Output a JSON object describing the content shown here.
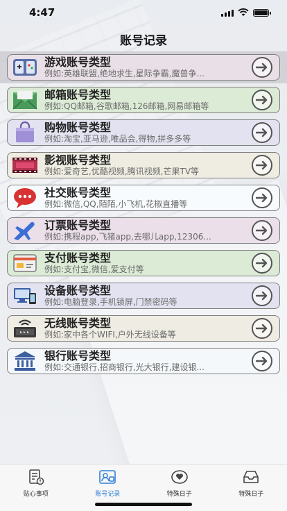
{
  "status": {
    "time": "4:47"
  },
  "nav": {
    "title": "账号记录"
  },
  "items": [
    {
      "title": "游戏账号类型",
      "subtitle": "例如:英雄联盟,绝地求生,星际争霸,魔兽争...",
      "bg": "#e9dfe6",
      "icon": "gamepad-icon"
    },
    {
      "title": "邮箱账号类型",
      "subtitle": "例如:QQ邮箱,谷歌邮箱,126邮箱,网易邮箱等",
      "bg": "#dcebd6",
      "icon": "envelope-icon"
    },
    {
      "title": "购物账号类型",
      "subtitle": "例如:淘宝,亚马逊,唯品会,得物,拼多多等",
      "bg": "#e2e2f0",
      "icon": "shopping-bag-icon"
    },
    {
      "title": "影视账号类型",
      "subtitle": "例如:爱奇艺,优酷视频,腾讯视频,芒果TV等",
      "bg": "#efece1",
      "icon": "film-icon"
    },
    {
      "title": "社交账号类型",
      "subtitle": "例如:微信,QQ,陌陌,小飞机,花椒直播等",
      "bg": "#f7fbfd",
      "icon": "chat-bubble-icon"
    },
    {
      "title": "订票账号类型",
      "subtitle": "例如:携程app,飞猪app,去哪儿app,12306...",
      "bg": "#ebdfe9",
      "icon": "airplane-icon"
    },
    {
      "title": "支付账号类型",
      "subtitle": "例如:支付宝,微信,爱支付等",
      "bg": "#dcebd6",
      "icon": "payment-card-icon"
    },
    {
      "title": "设备账号类型",
      "subtitle": "例如:电脑登录,手机锁屏,门禁密码等",
      "bg": "#e2e2f0",
      "icon": "devices-icon"
    },
    {
      "title": "无线账号类型",
      "subtitle": "例如:家中各个WIFI,户外无线设备等",
      "bg": "#eeece3",
      "icon": "wifi-router-icon"
    },
    {
      "title": "银行账号类型",
      "subtitle": "例如:交通银行,招商银行,光大银行,建设银...",
      "bg": "#f4f8fa",
      "icon": "bank-icon"
    }
  ],
  "tabs": [
    {
      "label": "贴心事项",
      "icon": "notes-icon",
      "active": false
    },
    {
      "label": "账号记录",
      "icon": "account-record-icon",
      "active": true
    },
    {
      "label": "特殊日子",
      "icon": "heart-day-icon",
      "active": false
    },
    {
      "label": "特殊日子",
      "icon": "inbox-tray-icon",
      "active": false
    }
  ],
  "colors": {
    "accent": "#2f7fd8",
    "item_border": "#808080"
  }
}
